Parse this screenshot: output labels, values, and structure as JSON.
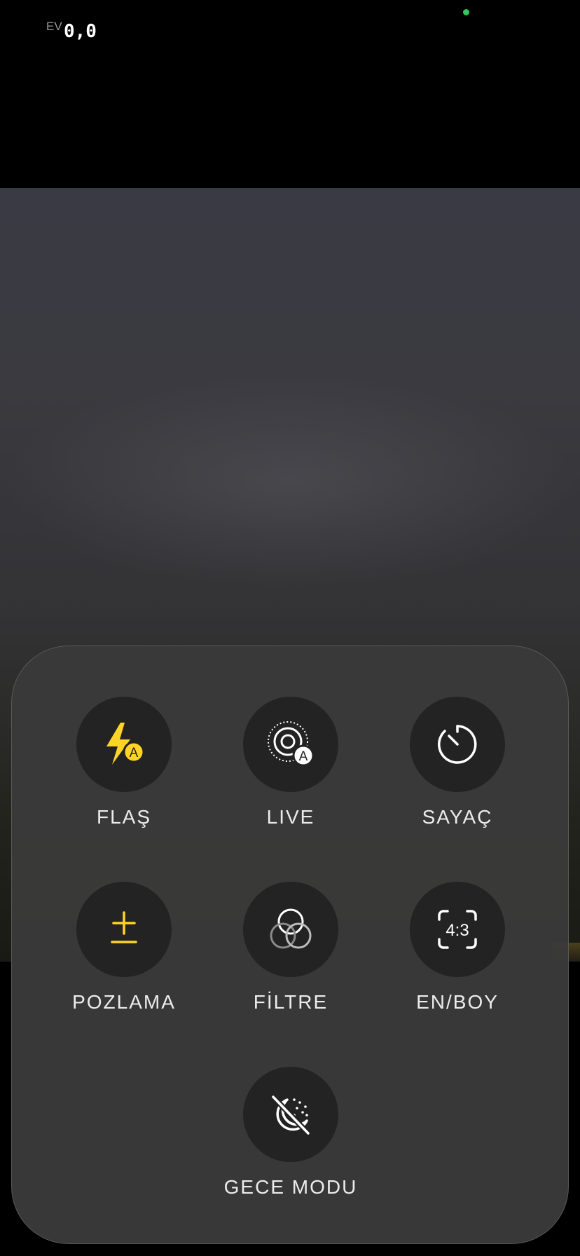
{
  "top": {
    "ev_label": "EV",
    "ev_value": "0,0",
    "camera_indicator_color": "#34c759"
  },
  "controls": [
    {
      "id": "flash",
      "label": "FLAŞ",
      "icon": "flash-auto-icon"
    },
    {
      "id": "live",
      "label": "LIVE",
      "icon": "live-photo-auto-icon"
    },
    {
      "id": "timer",
      "label": "SAYAÇ",
      "icon": "timer-icon"
    },
    {
      "id": "exposure",
      "label": "POZLAMA",
      "icon": "exposure-plus-minus-icon"
    },
    {
      "id": "filter",
      "label": "FİLTRE",
      "icon": "filter-circles-icon"
    },
    {
      "id": "aspect",
      "label": "EN/BOY",
      "icon": "aspect-ratio-icon",
      "icon_text": "4:3"
    },
    {
      "id": "night",
      "label": "GECE MODU",
      "icon": "night-mode-off-icon"
    }
  ],
  "colors": {
    "accent_yellow": "#ffd426",
    "icon_white": "#ffffff",
    "panel": "#3a3a3a",
    "button": "#232323"
  }
}
